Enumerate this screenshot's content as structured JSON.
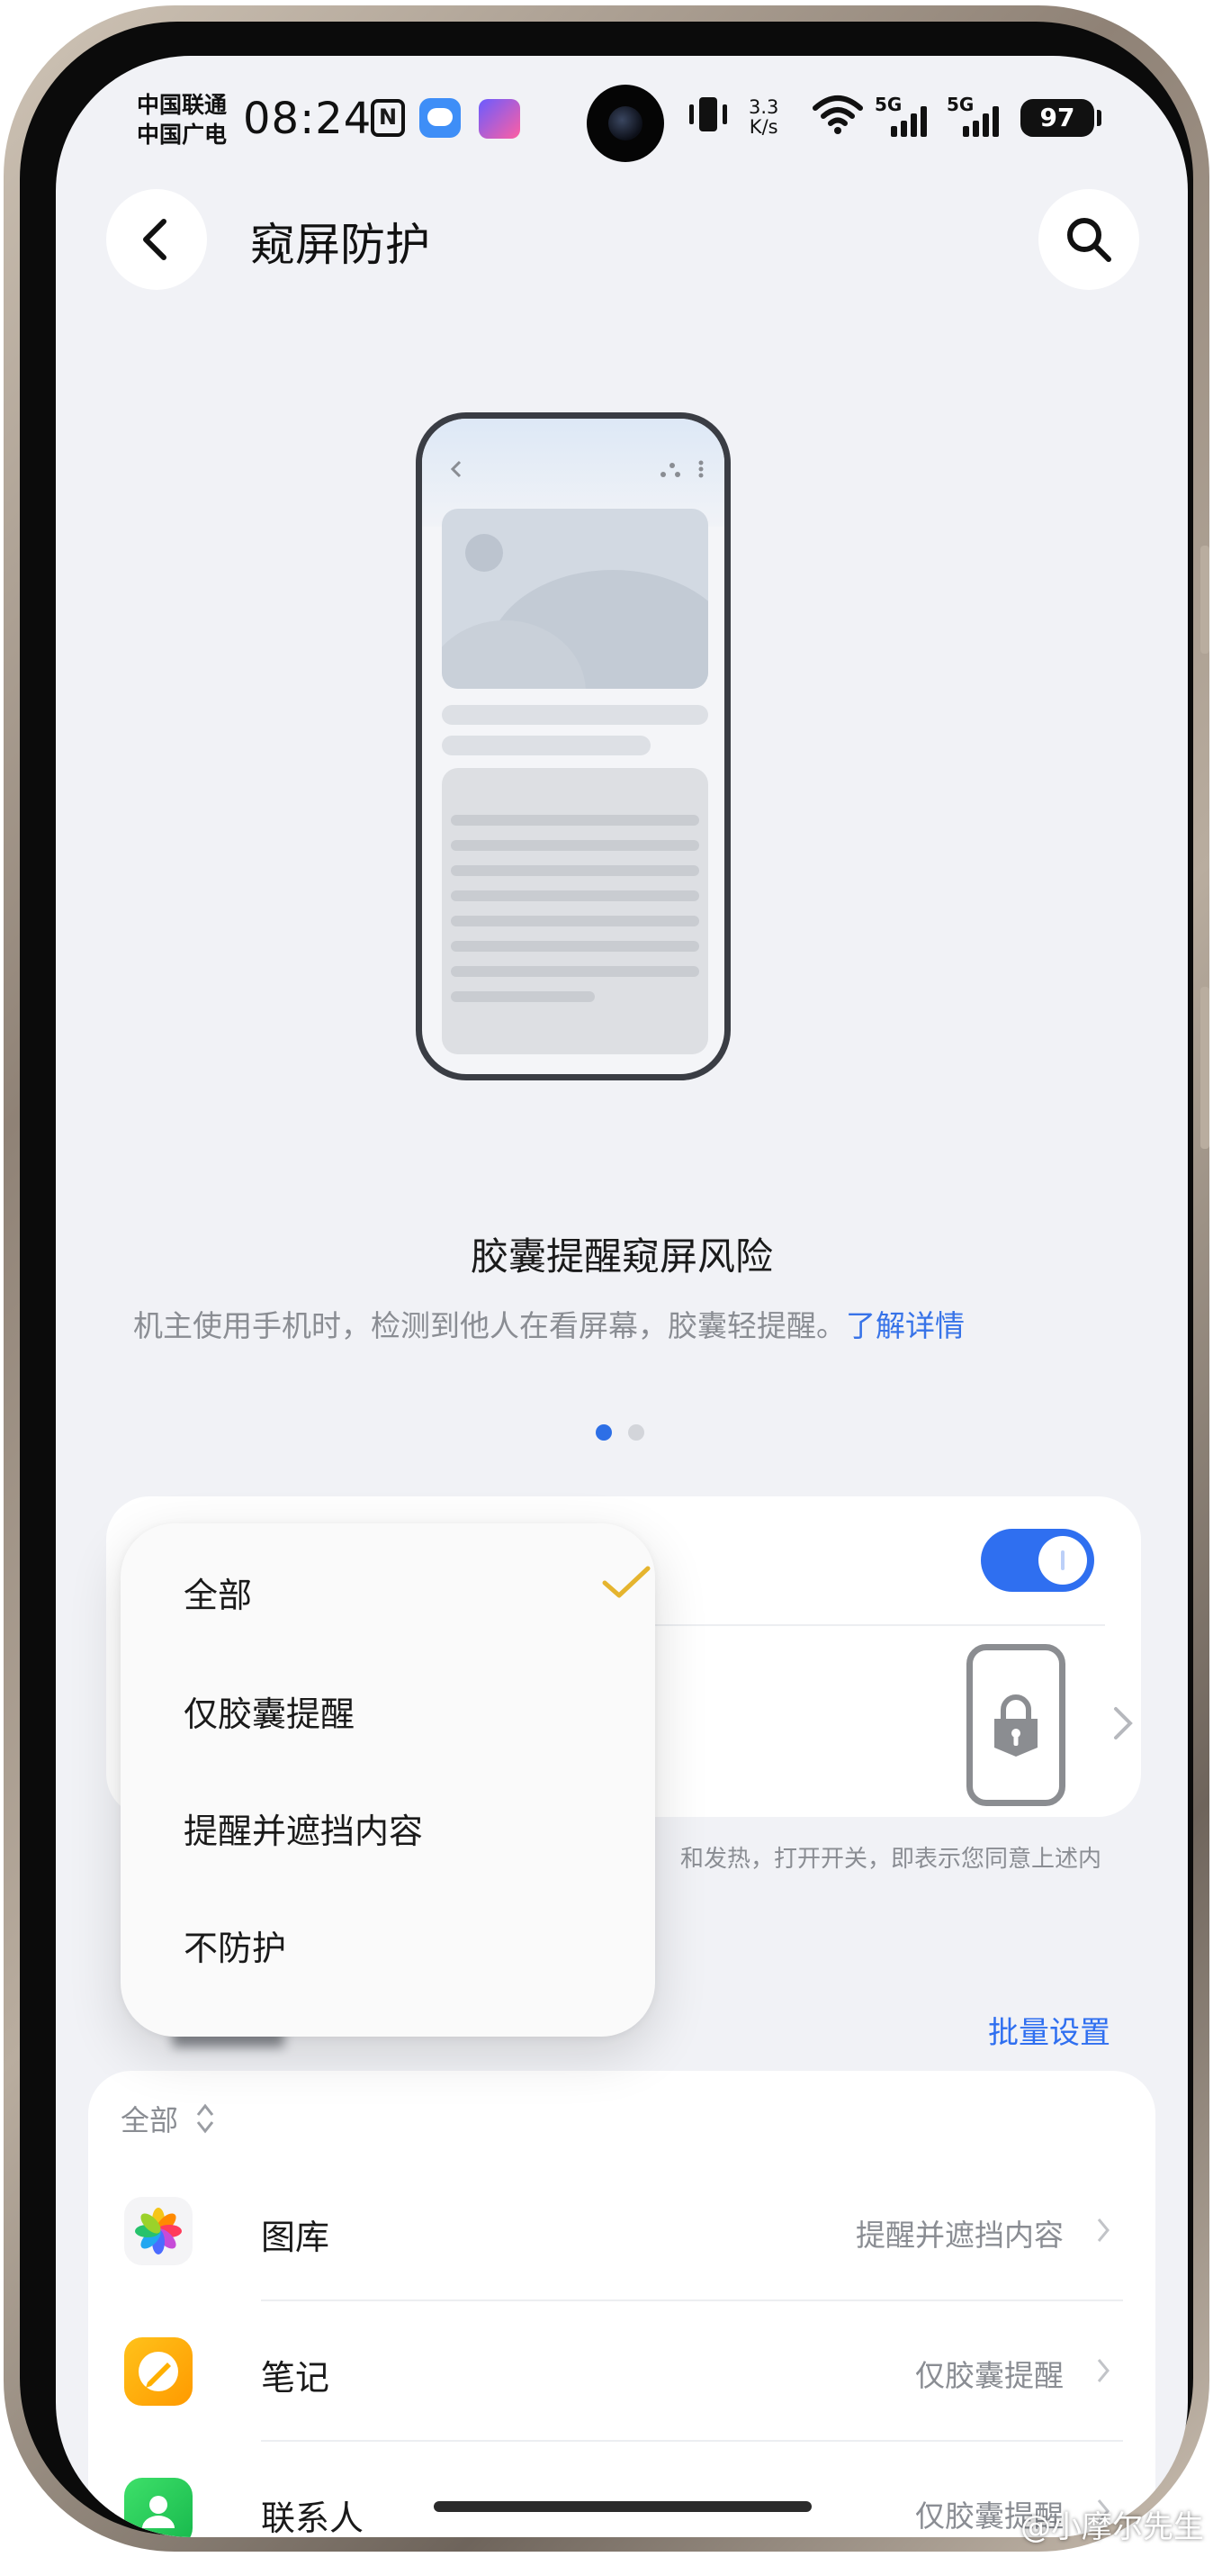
{
  "status_bar": {
    "carrier_1": "中国联通",
    "carrier_2": "中国广电",
    "time": "08:24",
    "nfc": "N",
    "net_speed_value": "3.3",
    "net_speed_unit": "K/s",
    "sim1_label": "5G",
    "sim2_label": "5G",
    "battery": "97"
  },
  "header": {
    "title": "窥屏防护"
  },
  "feature": {
    "title": "胶囊提醒窥屏风险",
    "description": "机主使用手机时，检测到他人在看屏幕，胶囊轻提醒。",
    "learn_more": "了解详情",
    "page_index": 1,
    "page_count": 2
  },
  "settings_card": {
    "toggle_on": true
  },
  "note_visible_part": "和发热，打开开关，即表示您同意上述内",
  "batch_settings": "批量设置",
  "dropdown": {
    "options": [
      "全部",
      "仅胶囊提醒",
      "提醒并遮挡内容",
      "不防护"
    ],
    "selected": "全部"
  },
  "app_list": {
    "filter_label": "全部",
    "apps": [
      {
        "name": "图库",
        "value": "提醒并遮挡内容",
        "icon": "gallery-icon"
      },
      {
        "name": "笔记",
        "value": "仅胶囊提醒",
        "icon": "notes-icon"
      },
      {
        "name": "联系人",
        "value": "仅胶囊提醒",
        "icon": "contacts-icon"
      }
    ]
  },
  "watermark": "@小摩尔先生",
  "colors": {
    "accent": "#2f6ff0",
    "check": "#e5b42e",
    "background": "#f1f2f6"
  }
}
